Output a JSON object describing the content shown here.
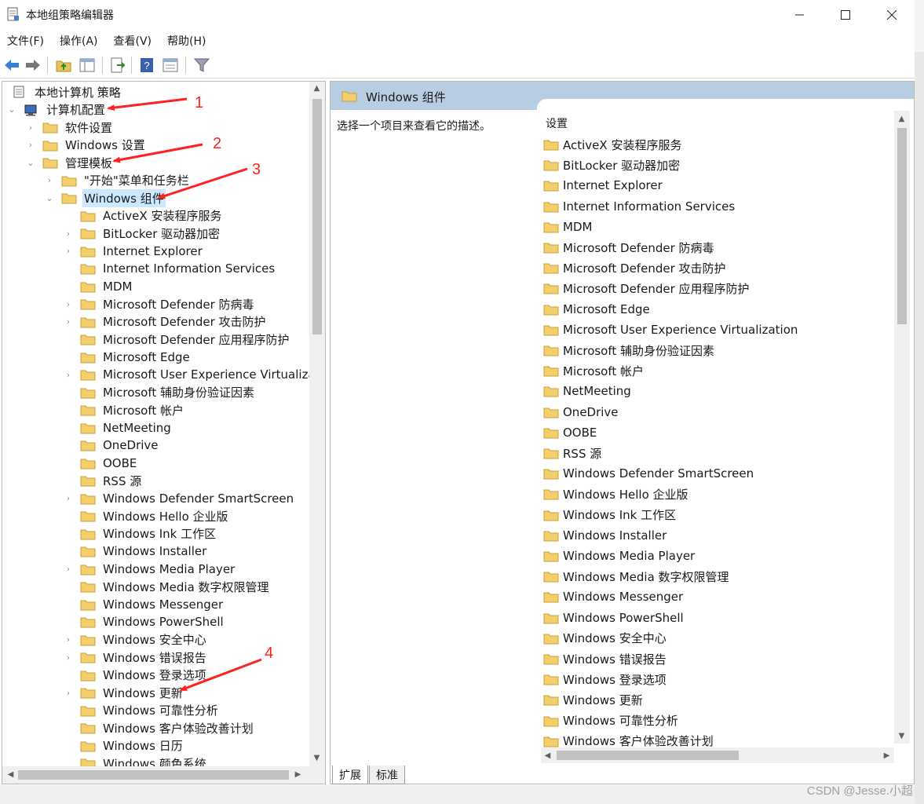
{
  "window": {
    "title": "本地组策略编辑器",
    "minimize_icon": "minimize-icon",
    "maximize_icon": "maximize-icon",
    "close_icon": "close-icon"
  },
  "menu": [
    "文件(F)",
    "操作(A)",
    "查看(V)",
    "帮助(H)"
  ],
  "toolbar": [
    "back-icon",
    "forward-icon",
    "up-folder-icon",
    "show-hide-tree-icon",
    "export-list-icon",
    "help-icon",
    "properties-icon",
    "filter-icon"
  ],
  "tree": {
    "root": "本地计算机 策略",
    "computer_config": "计算机配置",
    "software_settings": "软件设置",
    "windows_settings": "Windows 设置",
    "admin_templates": "管理模板",
    "start_menu": "\"开始\"菜单和任务栏",
    "windows_components": "Windows 组件",
    "children": [
      {
        "label": "ActiveX 安装程序服务",
        "expandable": false
      },
      {
        "label": "BitLocker 驱动器加密",
        "expandable": true
      },
      {
        "label": "Internet Explorer",
        "expandable": true
      },
      {
        "label": "Internet Information Services",
        "expandable": false
      },
      {
        "label": "MDM",
        "expandable": false
      },
      {
        "label": "Microsoft Defender 防病毒",
        "expandable": true
      },
      {
        "label": "Microsoft Defender 攻击防护",
        "expandable": true
      },
      {
        "label": "Microsoft Defender 应用程序防护",
        "expandable": false
      },
      {
        "label": "Microsoft Edge",
        "expandable": false
      },
      {
        "label": "Microsoft User Experience Virtualization",
        "expandable": true
      },
      {
        "label": "Microsoft 辅助身份验证因素",
        "expandable": false
      },
      {
        "label": "Microsoft 帐户",
        "expandable": false
      },
      {
        "label": "NetMeeting",
        "expandable": false
      },
      {
        "label": "OneDrive",
        "expandable": false
      },
      {
        "label": "OOBE",
        "expandable": false
      },
      {
        "label": "RSS 源",
        "expandable": false
      },
      {
        "label": "Windows Defender SmartScreen",
        "expandable": true
      },
      {
        "label": "Windows Hello 企业版",
        "expandable": false
      },
      {
        "label": "Windows Ink 工作区",
        "expandable": false
      },
      {
        "label": "Windows Installer",
        "expandable": false
      },
      {
        "label": "Windows Media Player",
        "expandable": true
      },
      {
        "label": "Windows Media 数字权限管理",
        "expandable": false
      },
      {
        "label": "Windows Messenger",
        "expandable": false
      },
      {
        "label": "Windows PowerShell",
        "expandable": false
      },
      {
        "label": "Windows 安全中心",
        "expandable": true
      },
      {
        "label": "Windows 错误报告",
        "expandable": true
      },
      {
        "label": "Windows 登录选项",
        "expandable": false
      },
      {
        "label": "Windows 更新",
        "expandable": true
      },
      {
        "label": "Windows 可靠性分析",
        "expandable": false
      },
      {
        "label": "Windows 客户体验改善计划",
        "expandable": false
      },
      {
        "label": "Windows 日历",
        "expandable": false
      },
      {
        "label": "Windows 颜色系统",
        "expandable": false
      }
    ]
  },
  "right_pane": {
    "header": "Windows 组件",
    "description": "选择一个项目来查看它的描述。",
    "list_header": "设置",
    "items": [
      "ActiveX 安装程序服务",
      "BitLocker 驱动器加密",
      "Internet Explorer",
      "Internet Information Services",
      "MDM",
      "Microsoft Defender 防病毒",
      "Microsoft Defender 攻击防护",
      "Microsoft Defender 应用程序防护",
      "Microsoft Edge",
      "Microsoft User Experience Virtualization",
      "Microsoft 辅助身份验证因素",
      "Microsoft 帐户",
      "NetMeeting",
      "OneDrive",
      "OOBE",
      "RSS 源",
      "Windows Defender SmartScreen",
      "Windows Hello 企业版",
      "Windows Ink 工作区",
      "Windows Installer",
      "Windows Media Player",
      "Windows Media 数字权限管理",
      "Windows Messenger",
      "Windows PowerShell",
      "Windows 安全中心",
      "Windows 错误报告",
      "Windows 登录选项",
      "Windows 更新",
      "Windows 可靠性分析",
      "Windows 客户体验改善计划"
    ]
  },
  "tabs": [
    "扩展",
    "标准"
  ],
  "watermark": "CSDN @Jesse.小超",
  "annotations": [
    "1",
    "2",
    "3",
    "4"
  ],
  "colors": {
    "selection": "#cce8ff",
    "header_bar": "#b8cde2",
    "annotation": "#ff2020",
    "folder": "#f3cf6b"
  }
}
